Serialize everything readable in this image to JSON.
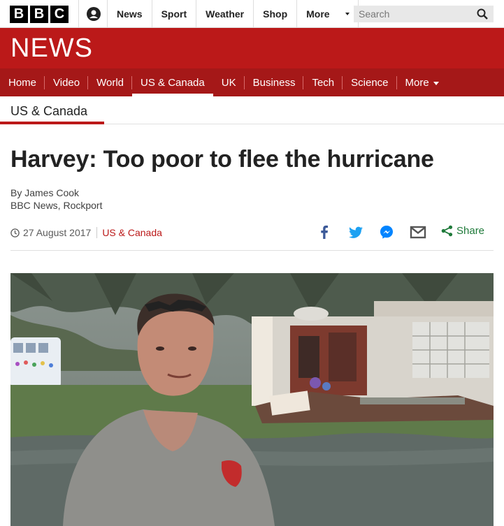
{
  "logo": {
    "letters": [
      "B",
      "B",
      "C"
    ]
  },
  "global_nav": {
    "items": [
      "News",
      "Sport",
      "Weather",
      "Shop"
    ],
    "more_label": "More"
  },
  "search": {
    "placeholder": "Search"
  },
  "banner": {
    "title": "NEWS"
  },
  "section_nav": {
    "items": [
      "Home",
      "Video",
      "World",
      "US & Canada",
      "UK",
      "Business",
      "Tech",
      "Science"
    ],
    "active": "US & Canada",
    "more_label": "More"
  },
  "section": {
    "title": "US & Canada"
  },
  "article": {
    "headline": "Harvey: Too poor to flee the hurricane",
    "author": "By James Cook",
    "location": "BBC News, Rockport",
    "date": "27 August 2017",
    "category": "US & Canada"
  },
  "share": {
    "label": "Share"
  },
  "colors": {
    "brand_red": "#bb1919",
    "nav_red": "#a51818",
    "share_green": "#1f7a3a"
  }
}
